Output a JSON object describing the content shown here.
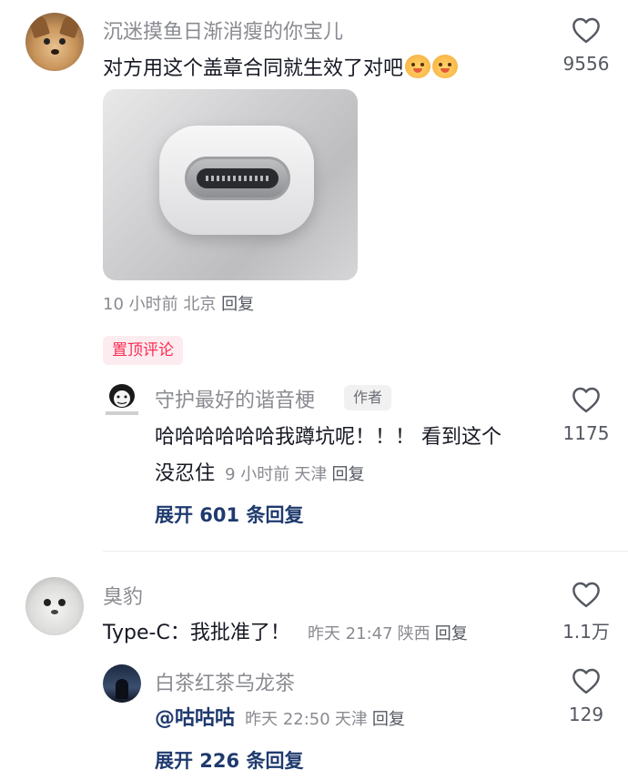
{
  "comments": [
    {
      "username": "沉迷摸鱼日渐消瘦的你宝儿",
      "text": "对方用这个盖章合同就生效了对吧",
      "emoji": [
        "cool-face-emoji",
        "cool-face-emoji"
      ],
      "image_alt": "usb-c-port-photo",
      "time": "10 小时前",
      "location": "北京",
      "reply_label": "回复",
      "likes": "9556",
      "replies": [
        {
          "username": "守护最好的谐音梗",
          "author_badge": "作者",
          "text_line1": "哈哈哈哈哈哈我蹲坑呢！！！ 看到这个",
          "text_line2": "没忍住",
          "time": "9 小时前",
          "location": "天津",
          "reply_label": "回复",
          "likes": "1175"
        }
      ],
      "pinned_label": "置顶评论",
      "expand_label": "展开 601 条回复"
    },
    {
      "username": "臭豹",
      "text": "Type-C：我批准了！",
      "time": "昨天 21:47",
      "location": "陕西",
      "reply_label": "回复",
      "likes": "1.1万",
      "replies": [
        {
          "username": "白茶红茶乌龙茶",
          "mention": "@咕咕咕",
          "time": "昨天 22:50",
          "location": "天津",
          "reply_label": "回复",
          "likes": "129"
        }
      ],
      "expand_label": "展开 226 条回复"
    }
  ],
  "colors": {
    "accent_red": "#fe2c55",
    "link_blue": "#1f3a6e",
    "meta_gray": "#8a8b91"
  }
}
